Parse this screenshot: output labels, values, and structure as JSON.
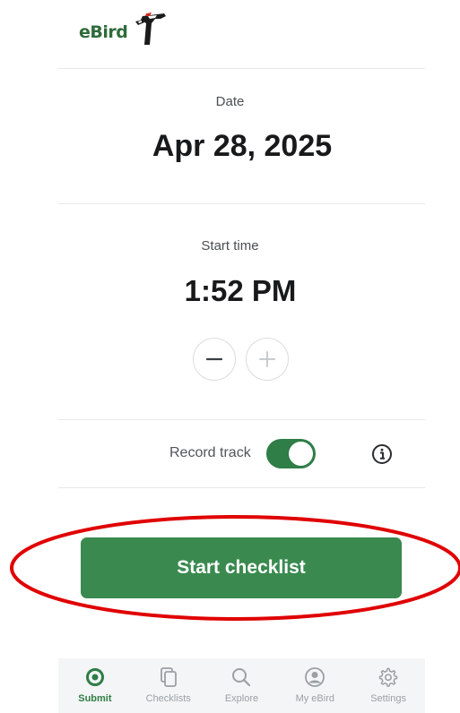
{
  "logo": {
    "text": "eBird"
  },
  "date": {
    "label": "Date",
    "value": "Apr 28, 2025"
  },
  "start_time": {
    "label": "Start time",
    "value": "1:52 PM",
    "decrement_icon": "minus-icon",
    "increment_icon": "plus-icon"
  },
  "record_track": {
    "label": "Record track",
    "enabled": true
  },
  "start_button": {
    "label": "Start checklist"
  },
  "tabs": [
    {
      "label": "Submit",
      "icon": "submit-icon",
      "active": true
    },
    {
      "label": "Checklists",
      "icon": "checklists-icon",
      "active": false
    },
    {
      "label": "Explore",
      "icon": "search-icon",
      "active": false
    },
    {
      "label": "My eBird",
      "icon": "profile-icon",
      "active": false
    },
    {
      "label": "Settings",
      "icon": "gear-icon",
      "active": false
    }
  ],
  "colors": {
    "accent": "#2f7d47",
    "button": "#3a8a50",
    "annotation": "#e00000"
  }
}
